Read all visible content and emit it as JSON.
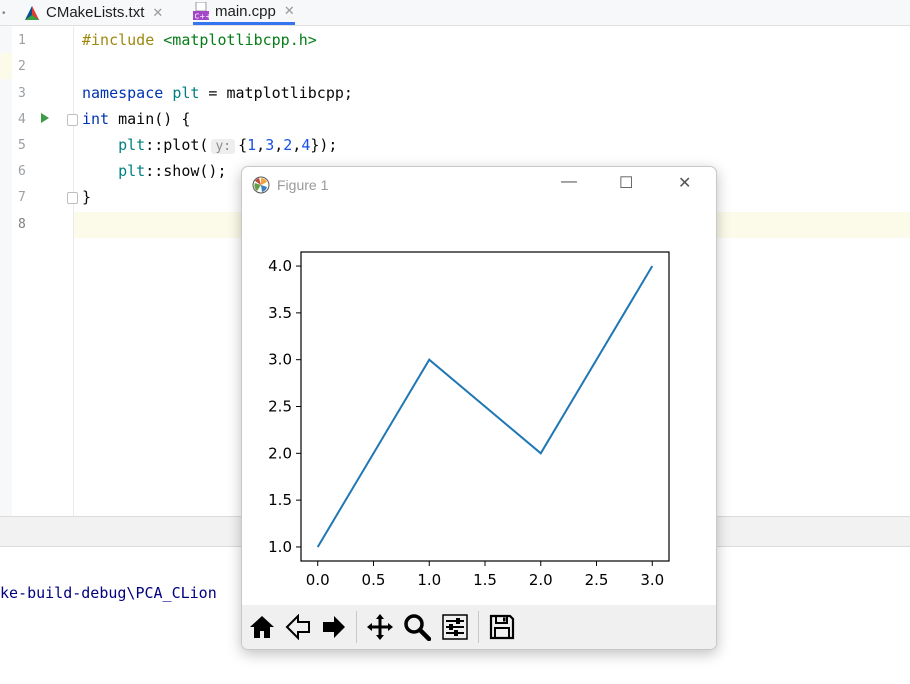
{
  "tabs": [
    {
      "label": "CMakeLists.txt",
      "close": "✕",
      "active": false
    },
    {
      "label": "main.cpp",
      "close": "✕",
      "active": true
    }
  ],
  "editor": {
    "line_numbers": [
      "1",
      "2",
      "3",
      "4",
      "5",
      "6",
      "7",
      "8"
    ],
    "lines": {
      "l1_pp": "#include",
      "l1_inc": "<matplotlibcpp.h>",
      "l3_kw": "namespace",
      "l3_ns": "plt",
      "l3_rest": " = matplotlibcpp;",
      "l4_kw": "int",
      "l4_rest": " main() {",
      "l5_ns": "plt",
      "l5_a": "::plot(",
      "l5_hint": "y:",
      "l5_b": "{",
      "l5_n1": "1",
      "l5_n2": "3",
      "l5_n3": "2",
      "l5_n4": "4",
      "l5_end": "});",
      "l6_ns": "plt",
      "l6_rest": "::show();",
      "l7": "}"
    }
  },
  "console": {
    "text": "ke-build-debug\\PCA_CLion"
  },
  "figure": {
    "title": "Figure 1",
    "minimize": "—",
    "maximize": "☐",
    "close": "✕",
    "toolbar": [
      "home-icon",
      "back-icon",
      "forward-icon",
      "pan-icon",
      "zoom-icon",
      "configure-icon",
      "save-icon"
    ]
  },
  "chart_data": {
    "type": "line",
    "x": [
      0,
      1,
      2,
      3
    ],
    "series": [
      {
        "values": [
          1,
          3,
          2,
          4
        ],
        "color": "#1f77b4"
      }
    ],
    "xlim": [
      -0.15,
      3.15
    ],
    "ylim": [
      0.85,
      4.15
    ],
    "xticks": [
      "0.0",
      "0.5",
      "1.0",
      "1.5",
      "2.0",
      "2.5",
      "3.0"
    ],
    "yticks": [
      "1.0",
      "1.5",
      "2.0",
      "2.5",
      "3.0",
      "3.5",
      "4.0"
    ],
    "grid": false,
    "title": "",
    "xlabel": "",
    "ylabel": ""
  }
}
